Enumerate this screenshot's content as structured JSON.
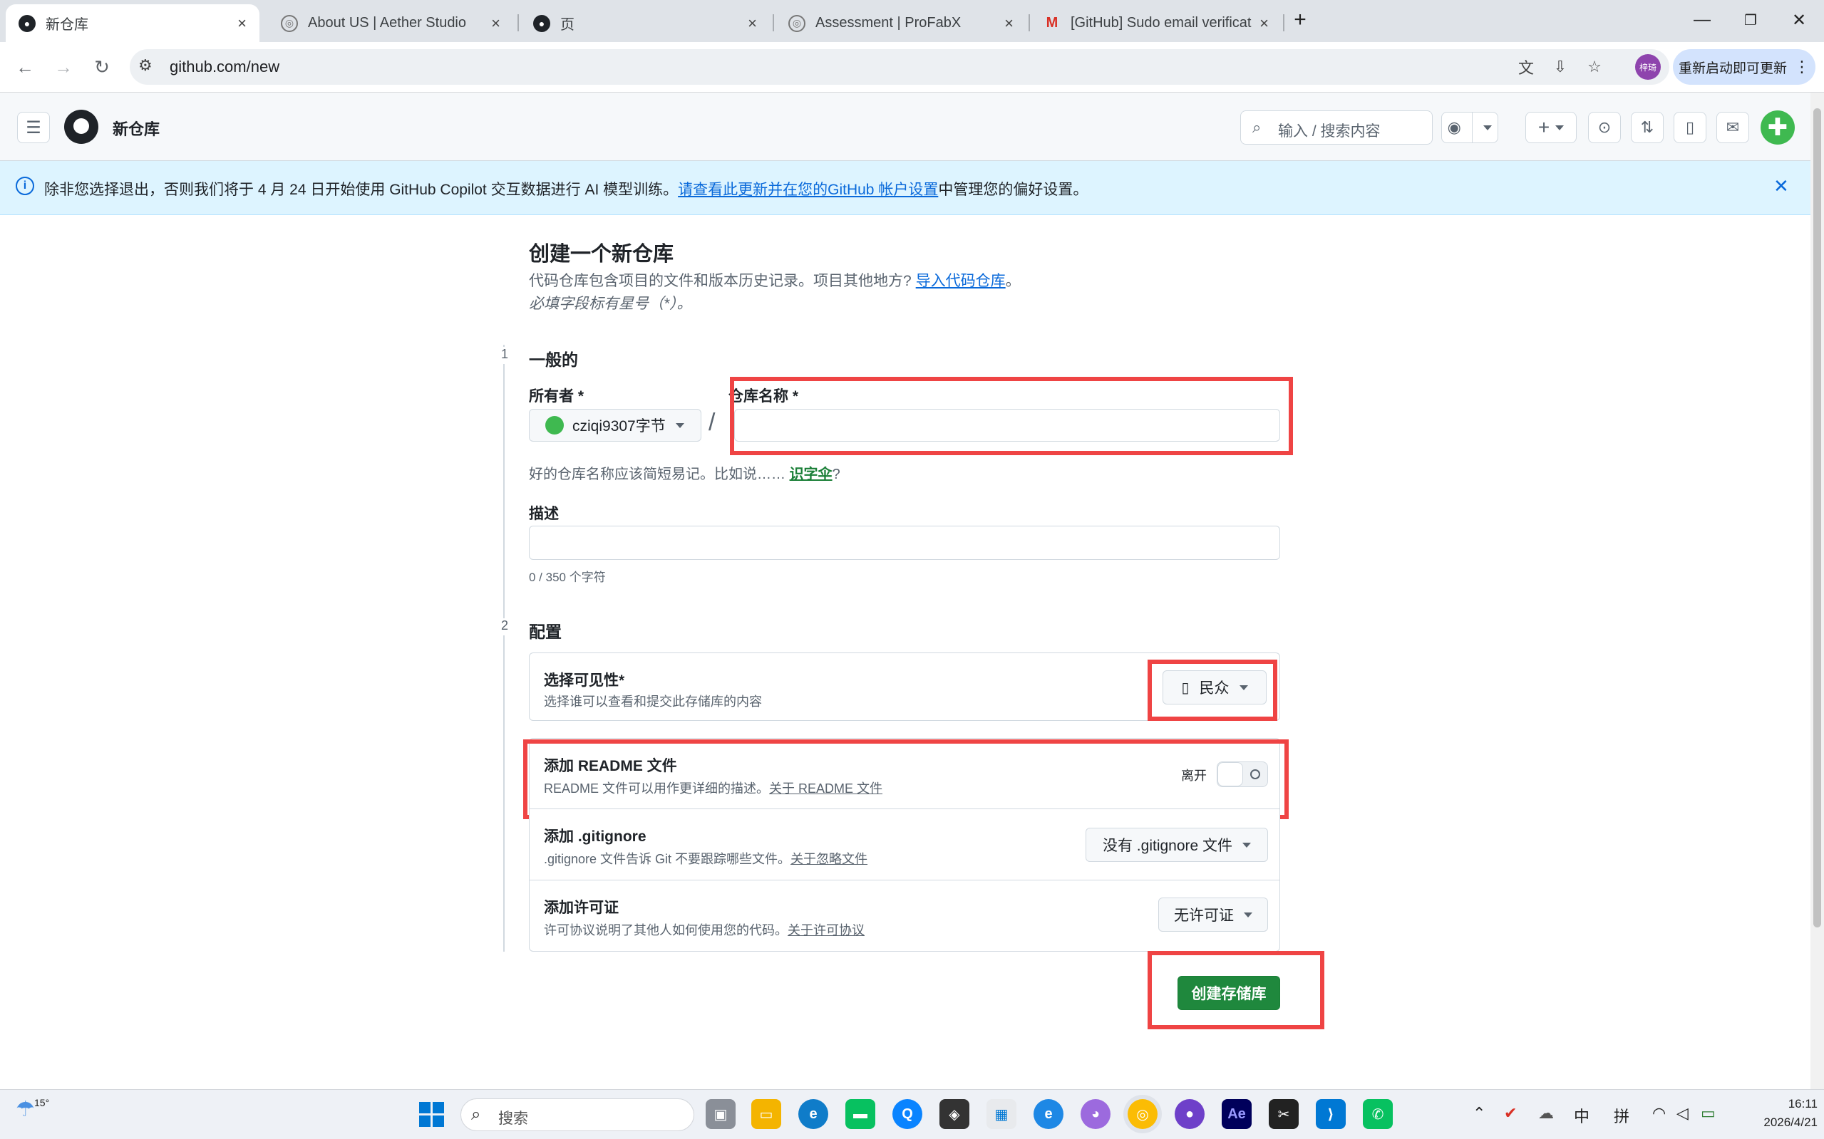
{
  "browser": {
    "tabs": [
      {
        "title": "新仓库",
        "icon": "github-icon",
        "active": true
      },
      {
        "title": "About US | Aether Studio",
        "icon": "globe-icon",
        "active": false
      },
      {
        "title": "页",
        "icon": "github-icon",
        "active": false
      },
      {
        "title": "Assessment | ProFabX",
        "icon": "globe-icon",
        "active": false
      },
      {
        "title": "[GitHub] Sudo email verificat",
        "icon": "gmail-icon",
        "active": false
      }
    ],
    "url": "github.com/new",
    "relaunch_label": "重新启动即可更新",
    "profile_initials": "梓琦"
  },
  "gh_header": {
    "page_title": "新仓库",
    "search_placeholder": "输入 / 搜索内容",
    "search_key": "/"
  },
  "banner": {
    "text_before": "除非您选择退出，否则我们将于 4 月 24 日开始使用 GitHub Copilot 交互数据进行 AI 模型训练。",
    "link_text": "请查看此更新并在您的GitHub 帐户设置",
    "text_after": "中管理您的偏好设置。"
  },
  "form": {
    "title": "创建一个新仓库",
    "subtitle_before": "代码仓库包含项目的文件和版本历史记录。项目其他地方?",
    "import_link": "导入代码仓库",
    "subtitle_after": "。",
    "required_note": "必填字段标有星号（*）。",
    "step1": {
      "num": "1",
      "label": "一般的"
    },
    "owner_label": "所有者 *",
    "owner_value": "cziqi9307字节",
    "slash": "/",
    "repo_name_label": "仓库名称 *",
    "repo_name_value": "",
    "hint_before": "好的仓库名称应该简短易记。比如说……",
    "hint_suggestion": "识字伞",
    "hint_after": "?",
    "description_label": "描述",
    "description_value": "",
    "char_count": "0 / 350 个字符",
    "step2": {
      "num": "2",
      "label": "配置"
    },
    "visibility": {
      "title": "选择可见性*",
      "desc": "选择谁可以查看和提交此存储库的内容",
      "value": "民众"
    },
    "readme": {
      "title": "添加 README 文件",
      "desc": "README 文件可以用作更详细的描述。",
      "link": "关于 README 文件",
      "toggle_label": "离开",
      "toggle_on": false
    },
    "gitignore": {
      "title": "添加 .gitignore",
      "desc": ".gitignore 文件告诉 Git 不要跟踪哪些文件。",
      "link": "关于忽略文件",
      "value": "没有 .gitignore 文件"
    },
    "license": {
      "title": "添加许可证",
      "desc": "许可协议说明了其他人如何使用您的代码。",
      "link": "关于许可协议",
      "value": "无许可证"
    },
    "create_button": "创建存储库"
  },
  "colors": {
    "highlight": "#ef4444",
    "create_button_bg": "#1f883d",
    "link": "#0969da",
    "banner_bg": "#ddf4ff"
  },
  "taskbar": {
    "weather_temp": "15°",
    "search_placeholder": "搜索",
    "ime_lang": "中",
    "ime_mode": "拼",
    "time": "16:11",
    "date": "2026/4/21"
  }
}
